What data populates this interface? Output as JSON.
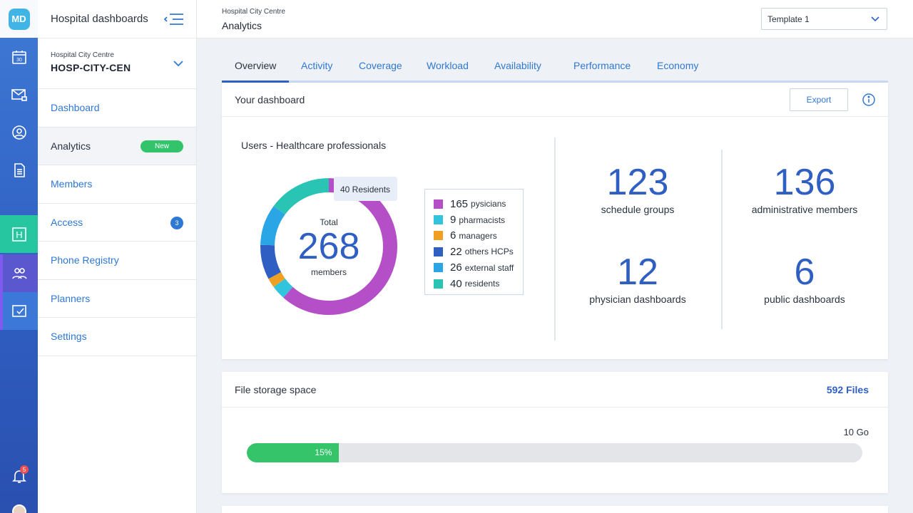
{
  "app": {
    "logo_text": "MD",
    "title": "Hospital dashboards"
  },
  "rail": {
    "items": [
      {
        "icon": "calendar-icon",
        "text": "30"
      },
      {
        "icon": "mail-lock-icon"
      },
      {
        "icon": "user-circle-icon"
      },
      {
        "icon": "document-icon"
      },
      {
        "icon": "hospital-icon",
        "text": "H"
      },
      {
        "icon": "users-icon"
      },
      {
        "icon": "dashboard-check-icon"
      }
    ],
    "notifications": {
      "icon": "bell-icon",
      "count": "5"
    },
    "colors": {
      "rail": "#2f5fc2",
      "hospital": "#26c7a0",
      "users": "#5a57cf"
    }
  },
  "org": {
    "name": "Hospital City Centre",
    "code": "HOSP-CITY-CEN"
  },
  "sidebar": {
    "items": [
      {
        "label": "Dashboard"
      },
      {
        "label": "Analytics",
        "badge": "New"
      },
      {
        "label": "Members"
      },
      {
        "label": "Access",
        "badge": "3"
      },
      {
        "label": "Phone Registry"
      },
      {
        "label": "Planners"
      },
      {
        "label": "Settings"
      }
    ]
  },
  "header": {
    "breadcrumb": "Hospital City Centre",
    "page_title": "Analytics",
    "template_select": "Template 1"
  },
  "tabs": [
    {
      "label": "Overview"
    },
    {
      "label": "Activity"
    },
    {
      "label": "Coverage"
    },
    {
      "label": "Workload"
    },
    {
      "label": "Availability"
    },
    {
      "label": "Performance"
    },
    {
      "label": "Economy"
    }
  ],
  "dashboard": {
    "title": "Your dashboard",
    "export_label": "Export",
    "users_title": "Users - Healthcare professionals",
    "total_label": "Total",
    "total": "268",
    "total_unit": "members",
    "tooltip": "40 Residents",
    "legend": [
      {
        "count": "165",
        "label": "pysicians",
        "color": "#b44fc7"
      },
      {
        "count": "9",
        "label": "pharmacists",
        "color": "#33c4dd"
      },
      {
        "count": "6",
        "label": "managers",
        "color": "#f0a020"
      },
      {
        "count": "22",
        "label": "others HCPs",
        "color": "#2f5fc2"
      },
      {
        "count": "26",
        "label": "external staff",
        "color": "#2aa5e6"
      },
      {
        "count": "40",
        "label": "residents",
        "color": "#29c4b3"
      }
    ],
    "stats": [
      {
        "value": "123",
        "label": "schedule groups"
      },
      {
        "value": "136",
        "label": "administrative members"
      },
      {
        "value": "12",
        "label": "physician dashboards"
      },
      {
        "value": "6",
        "label": "public dashboards"
      }
    ]
  },
  "storage": {
    "title": "File storage space",
    "files": "592 Files",
    "capacity": "10 Go",
    "used_percent_label": "15%",
    "used_fraction": 0.15
  }
}
